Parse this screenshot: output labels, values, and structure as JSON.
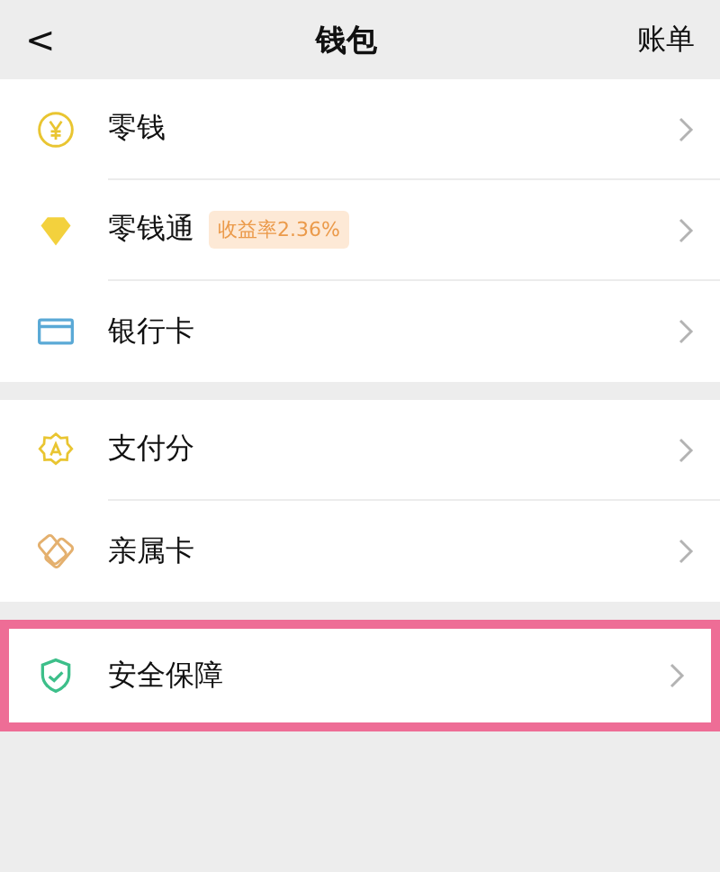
{
  "header": {
    "back": "<",
    "title": "钱包",
    "action": "账单"
  },
  "groups": [
    {
      "items": [
        {
          "kind": "coin",
          "label": "零钱",
          "highlighted": false
        },
        {
          "kind": "diamond",
          "label": "零钱通",
          "badge": "收益率2.36%",
          "highlighted": false
        },
        {
          "kind": "card",
          "label": "银行卡",
          "highlighted": false
        }
      ]
    },
    {
      "items": [
        {
          "kind": "badge",
          "label": "支付分",
          "highlighted": false
        },
        {
          "kind": "family",
          "label": "亲属卡",
          "highlighted": false
        }
      ]
    },
    {
      "items": [
        {
          "kind": "shield",
          "label": "安全保障",
          "highlighted": true
        }
      ]
    }
  ]
}
